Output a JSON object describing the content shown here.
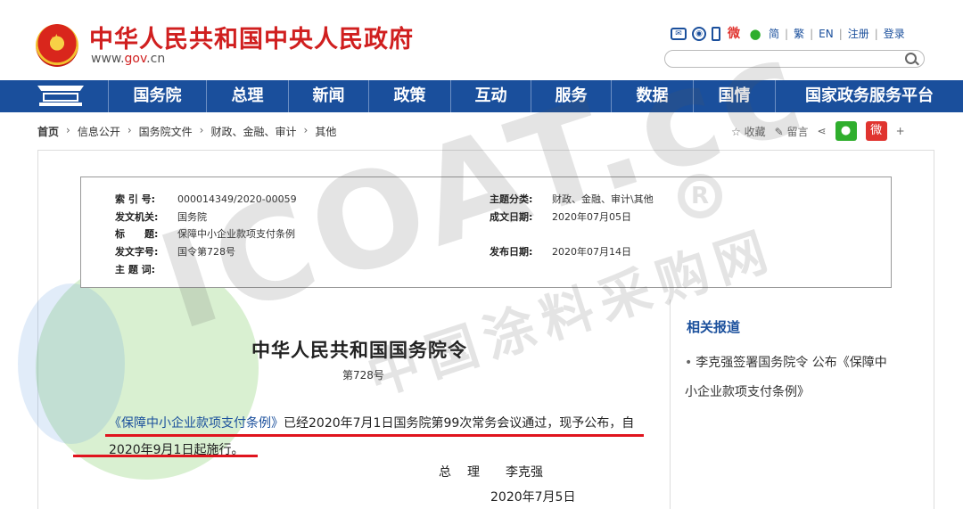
{
  "header": {
    "site_title": "中华人民共和国中央人民政府",
    "url_prefix": "www.",
    "url_domain": "gov",
    "url_suffix": ".cn",
    "links": [
      "简",
      "繁",
      "EN",
      "注册",
      "登录"
    ],
    "search_placeholder": ""
  },
  "nav": {
    "items": [
      "国务院",
      "总理",
      "新闻",
      "政策",
      "互动",
      "服务",
      "数据",
      "国情",
      "国家政务服务平台"
    ]
  },
  "breadcrumb": [
    "首页",
    "信息公开",
    "国务院文件",
    "财政、金融、审计",
    "其他"
  ],
  "tools": {
    "favorite": "收藏",
    "comment": "留言",
    "more": "+"
  },
  "meta": {
    "index_label": "索 引 号:",
    "index_value": "000014349/2020-00059",
    "issuer_label": "发文机关:",
    "issuer_value": "国务院",
    "title_label": "标　　题:",
    "title_value": "保障中小企业款项支付条例",
    "docno_label": "发文字号:",
    "docno_value": "国令第728号",
    "subject_label": "主 题 词:",
    "subject_value": "",
    "category_label": "主题分类:",
    "category_value": "财政、金融、审计\\其他",
    "created_label": "成文日期:",
    "created_value": "2020年07月05日",
    "published_label": "发布日期:",
    "published_value": "2020年07月14日"
  },
  "article": {
    "title": "中华人民共和国国务院令",
    "number": "第728号",
    "link_title": "《保障中小企业款项支付条例》",
    "p1_rest": "已经2020年7月1日国务院第99次常务会议通过，现予公布，自2020年9月1日起施行。",
    "sign_role": "总　理",
    "sign_name": "李克强",
    "sign_date": "2020年7月5日"
  },
  "side": {
    "title": "相关报道",
    "item": "李克强签署国务院令 公布《保障中小企业款项支付条例》"
  },
  "watermark": {
    "brand": "ICOAT.cc",
    "sub": "中国涂料采购网",
    "reg": "R"
  },
  "colors": {
    "brand_red": "#d01f1f",
    "nav_blue": "#1a4f9c",
    "underline_red": "#e0141e"
  }
}
